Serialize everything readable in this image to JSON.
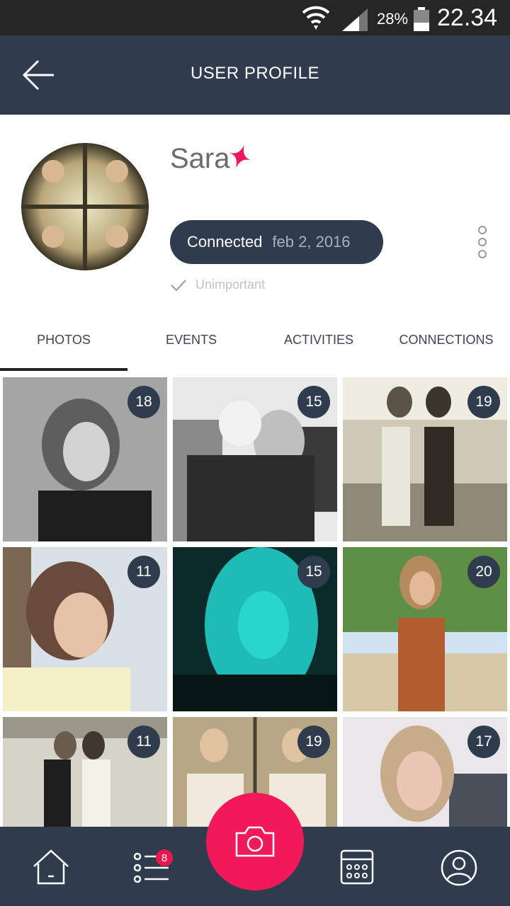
{
  "status_bar": {
    "battery": "28%",
    "time": "22.34"
  },
  "header": {
    "title": "USER PROFILE",
    "back_icon": "arrow-left-icon"
  },
  "profile": {
    "name": "Sara",
    "badge_icon": "star-icon",
    "status_label": "Connected",
    "status_date": "feb 2, 2016",
    "importance": "Unimportant"
  },
  "tabs": [
    {
      "label": "PHOTOS",
      "active": true
    },
    {
      "label": "EVENTS",
      "active": false
    },
    {
      "label": "ACTIVITIES",
      "active": false
    },
    {
      "label": "CONNECTIONS",
      "active": false
    }
  ],
  "photos": [
    {
      "count": "18"
    },
    {
      "count": "15"
    },
    {
      "count": "19"
    },
    {
      "count": "11"
    },
    {
      "count": "15"
    },
    {
      "count": "20"
    },
    {
      "count": "11"
    },
    {
      "count": "19"
    },
    {
      "count": "17"
    }
  ],
  "bottom_nav": {
    "items": [
      "home-icon",
      "list-icon",
      "camera-icon",
      "calendar-icon",
      "profile-icon"
    ],
    "list_badge": "8"
  },
  "colors": {
    "primary": "#2f3c4e",
    "accent": "#f2195b",
    "status_bar": "#262626"
  }
}
